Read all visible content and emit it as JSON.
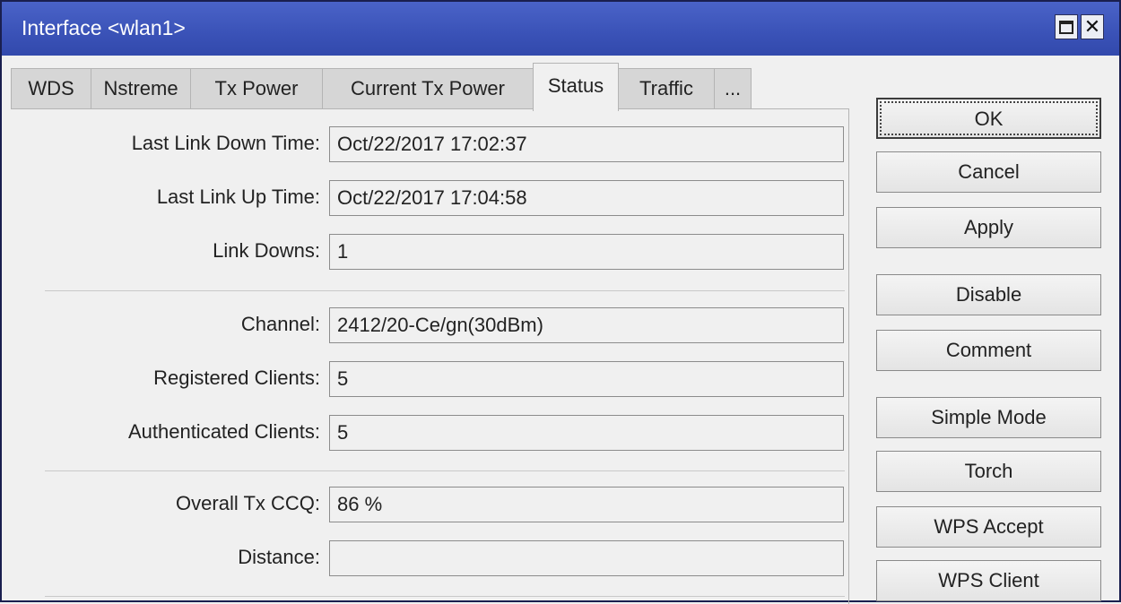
{
  "window": {
    "title": "Interface <wlan1>",
    "icons": {
      "maximize": "maximize-icon",
      "close": "close-icon"
    },
    "close_glyph": "✕"
  },
  "tabs": [
    {
      "label": "WDS"
    },
    {
      "label": "Nstreme"
    },
    {
      "label": "Tx Power"
    },
    {
      "label": "Current Tx Power"
    },
    {
      "label": "Status",
      "active": true
    },
    {
      "label": "Traffic"
    },
    {
      "label": "..."
    }
  ],
  "fields": {
    "last_link_down_time": {
      "label": "Last Link Down Time:",
      "value": "Oct/22/2017 17:02:37"
    },
    "last_link_up_time": {
      "label": "Last Link Up Time:",
      "value": "Oct/22/2017 17:04:58"
    },
    "link_downs": {
      "label": "Link Downs:",
      "value": "1"
    },
    "channel": {
      "label": "Channel:",
      "value": "2412/20-Ce/gn(30dBm)"
    },
    "registered_clients": {
      "label": "Registered Clients:",
      "value": "5"
    },
    "authenticated_clients": {
      "label": "Authenticated Clients:",
      "value": "5"
    },
    "overall_tx_ccq": {
      "label": "Overall Tx CCQ:",
      "value": "86 %"
    },
    "distance": {
      "label": "Distance:",
      "value": ""
    }
  },
  "buttons": {
    "ok": "OK",
    "cancel": "Cancel",
    "apply": "Apply",
    "disable": "Disable",
    "comment": "Comment",
    "simple_mode": "Simple Mode",
    "torch": "Torch",
    "wps_accept": "WPS Accept",
    "wps_client": "WPS Client"
  }
}
